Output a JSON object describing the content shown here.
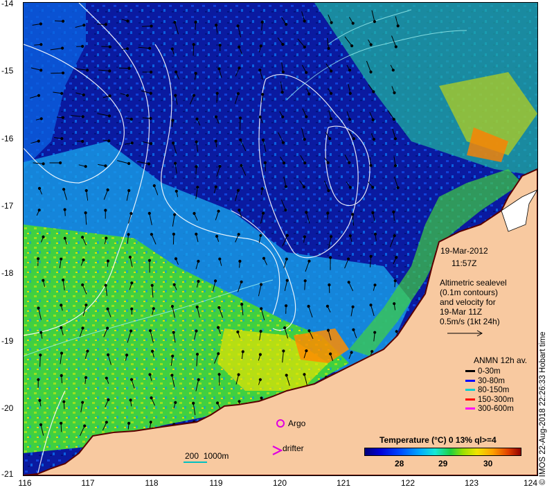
{
  "axes": {
    "y_ticks": [
      "-14",
      "-15",
      "-16",
      "-17",
      "-18",
      "-19",
      "-20",
      "-21"
    ],
    "x_ticks": [
      "116",
      "117",
      "118",
      "119",
      "120",
      "121",
      "122",
      "123",
      "124"
    ]
  },
  "annotation": {
    "date": "19-Mar-2012",
    "time": "11:57Z",
    "altimetric_lines": [
      "Altimetric sealevel",
      "(0.1m contours)",
      "and velocity for",
      "19-Mar 11Z",
      "0.5m/s (1kt 24h)"
    ]
  },
  "legend": {
    "title": "ANMN 12h av.",
    "items": [
      {
        "label": "0-30m",
        "color": "#000000"
      },
      {
        "label": "30-80m",
        "color": "#0000ff"
      },
      {
        "label": "80-150m",
        "color": "#00d0d0"
      },
      {
        "label": "150-300m",
        "color": "#ff0000"
      },
      {
        "label": "300-600m",
        "color": "#ff00ff"
      }
    ]
  },
  "markers": {
    "argo_label": "Argo",
    "drifter_label": "drifter"
  },
  "scale_bar": {
    "label": "200  1000m"
  },
  "colorbar": {
    "title": "Temperature (°C) 0 13% ql>=4",
    "ticks": [
      "28",
      "29",
      "30"
    ]
  },
  "credit": "© IMOS 22-Aug-2018 22:26:33 Hobart time",
  "colors": {
    "land": "#f8c9a0",
    "sea_cold": "#0a1aa0",
    "sea_warm": "#30d040",
    "contour": "#ffffff"
  }
}
